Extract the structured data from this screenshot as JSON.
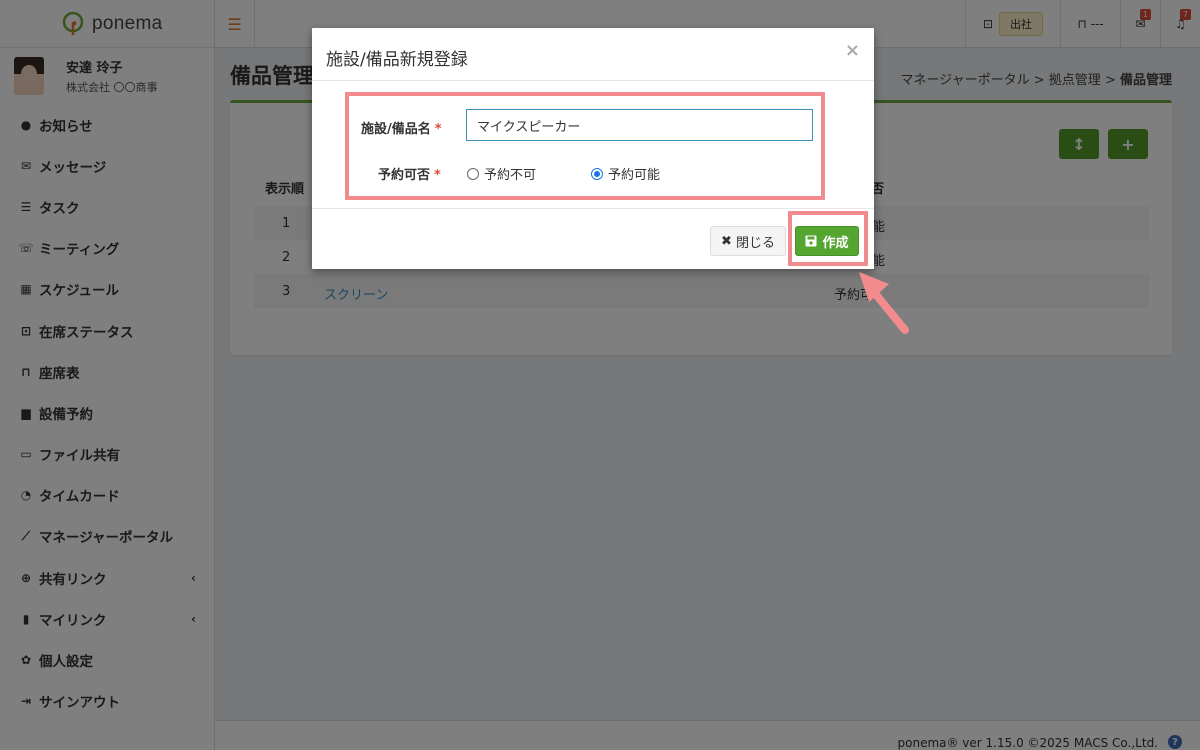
{
  "app": {
    "logo_text": "ponema"
  },
  "user": {
    "name": "安達 玲子",
    "company": "株式会社 〇〇商事"
  },
  "sidebar": {
    "items": [
      {
        "icon": "info-icon",
        "glyph": "●",
        "label": "お知らせ"
      },
      {
        "icon": "envelope-icon",
        "glyph": "✉",
        "label": "メッセージ"
      },
      {
        "icon": "task-list-icon",
        "glyph": "☰",
        "label": "タスク"
      },
      {
        "icon": "comments-icon",
        "glyph": "☏",
        "label": "ミーティング"
      },
      {
        "icon": "calendar-icon",
        "glyph": "▦",
        "label": "スケジュール"
      },
      {
        "icon": "presence-icon",
        "glyph": "⊡",
        "label": "在席ステータス"
      },
      {
        "icon": "chair-icon",
        "glyph": "⊓",
        "label": "座席表"
      },
      {
        "icon": "equipment-icon",
        "glyph": "▆",
        "label": "設備予約"
      },
      {
        "icon": "folder-icon",
        "glyph": "▭",
        "label": "ファイル共有"
      },
      {
        "icon": "clock-icon",
        "glyph": "◔",
        "label": "タイムカード"
      },
      {
        "icon": "line-chart-icon",
        "glyph": "⟋",
        "label": "マネージャーポータル"
      },
      {
        "icon": "globe-icon",
        "glyph": "⊕",
        "label": "共有リンク",
        "arrow": "‹"
      },
      {
        "icon": "bookmark-icon",
        "glyph": "▮",
        "label": "マイリンク",
        "arrow": "‹"
      },
      {
        "icon": "gear-icon",
        "glyph": "✿",
        "label": "個人設定"
      },
      {
        "icon": "sign-out-icon",
        "glyph": "⇥",
        "label": "サインアウト"
      }
    ]
  },
  "topbar": {
    "presence_label": "出社",
    "seat_label": "---",
    "message_count": "1",
    "notification_count": "7"
  },
  "page": {
    "title": "備品管理",
    "breadcrumb": [
      "マネージャーポータル",
      "拠点管理",
      "備品管理"
    ],
    "table": {
      "headers": [
        "表示順",
        "否"
      ],
      "rows": [
        {
          "order": "1",
          "name": "",
          "reservation": "能"
        },
        {
          "order": "2",
          "name": "",
          "reservation": "能"
        },
        {
          "order": "3",
          "name": "スクリーン",
          "reservation": "予約可"
        }
      ]
    }
  },
  "modal": {
    "title": "施設/備品新規登録",
    "close_glyph": "×",
    "name_label": "施設/備品名",
    "name_value": "マイクスピーカー",
    "required_mark": "*",
    "reservation_label": "予約可否",
    "options": [
      {
        "label": "予約不可",
        "checked": false
      },
      {
        "label": "予約可能",
        "checked": true
      }
    ],
    "close_button": "閉じる",
    "create_button": "作成"
  },
  "footer": {
    "text": "ponema® ver 1.15.0 ©2025 MACS Co.,Ltd.",
    "help_glyph": "?"
  },
  "colors": {
    "accent_green": "#55a630",
    "highlight": "#f28b8e",
    "link": "#3c8dbc",
    "brand_orange": "#e07b2c"
  }
}
